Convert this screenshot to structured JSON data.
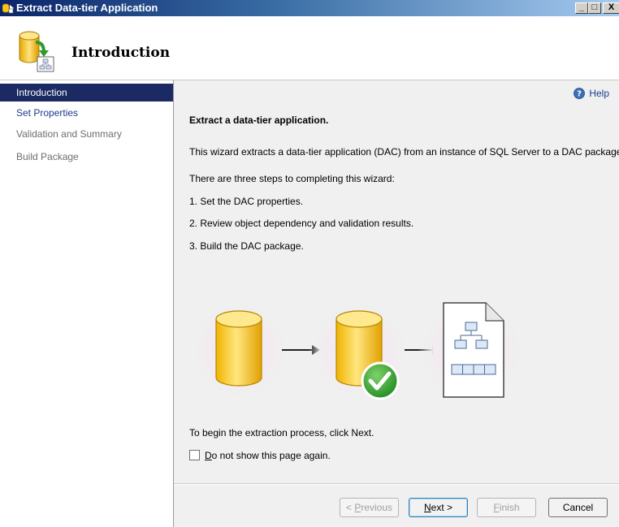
{
  "window": {
    "title": "Extract Data-tier Application",
    "controls": {
      "minimize": "_",
      "maximize": "□",
      "close": "X"
    }
  },
  "header": {
    "title": "Introduction",
    "icon": "database-extract-icon"
  },
  "sidebar": {
    "items": [
      {
        "label": "Introduction",
        "state": "active"
      },
      {
        "label": "Set Properties",
        "state": "link"
      },
      {
        "label": "Validation and Summary",
        "state": "disabled"
      },
      {
        "label": "Build Package",
        "state": "disabled"
      }
    ]
  },
  "main": {
    "help_label": "Help",
    "heading": "Extract a data-tier application.",
    "description": "This wizard extracts a data-tier application (DAC) from an instance of SQL Server to a DAC package.",
    "steps_intro": "There are three steps to completing this wizard:",
    "steps": [
      "1. Set the DAC properties.",
      "2. Review object dependency and validation results.",
      "3. Build the DAC package."
    ],
    "begin_text": "To begin the extraction process, click Next.",
    "checkbox": {
      "label_key": "D",
      "label_rest": "o not show this page again.",
      "checked": false
    }
  },
  "buttons": {
    "previous": {
      "prefix": "< ",
      "key": "P",
      "rest": "revious",
      "enabled": false
    },
    "next": {
      "key": "N",
      "rest": "ext >",
      "enabled": true
    },
    "finish": {
      "key": "F",
      "rest": "inish",
      "enabled": false
    },
    "cancel": {
      "label": "Cancel",
      "enabled": true
    }
  },
  "colors": {
    "accent": "#1c2a63",
    "link": "#1a3c8c",
    "disabled_text": "#6e6e6e",
    "panel_bg": "#f0f0f0"
  }
}
